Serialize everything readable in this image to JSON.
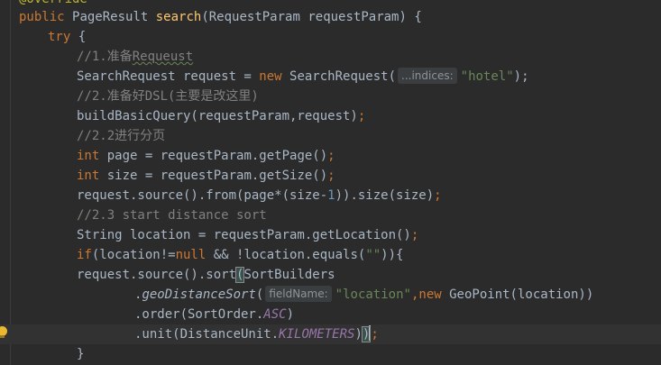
{
  "annotation": "@Override",
  "method_signature": {
    "public": "public",
    "return_type": "PageResult",
    "method_name": "search",
    "params": "(RequestParam requestParam) {"
  },
  "try_kw": "try",
  "try_brace": " {",
  "comment_1": "//1.准备Requeust",
  "line_request_a": "SearchRequest request = ",
  "new_kw": "new",
  "line_request_b": " SearchRequest(",
  "hint_indices": "...indices:",
  "str_hotel": "\"hotel\"",
  "line_request_end": ");",
  "comment_2": "//2.准备好DSL(主要是改这里)",
  "line_build": "buildBasicQuery(requestParam,request)",
  "semicolon": ";",
  "comment_2_2": "//2.2进行分页",
  "int_kw": "int",
  "line_page": " page = requestParam.getPage()",
  "line_size": " size = requestParam.getSize()",
  "line_from_a": "request.source().from(page*(size-",
  "num_one": "1",
  "line_from_b": ")).size(size)",
  "comment_2_3": "//2.3 start distance sort",
  "line_location": "String location = requestParam.getLocation()",
  "if_kw": "if",
  "line_if_a": "(location!=",
  "null_kw": "null",
  "line_if_b": " && !location.equals(",
  "str_empty": "\"\"",
  "line_if_c": ")){",
  "line_sort_a": "request.source().sort",
  "open_paren": "(",
  "line_sort_b": "SortBuilders",
  "dot": ".",
  "geo_method": "geoDistanceSort",
  "hint_fieldname": "fieldName:",
  "str_location": "\"location\"",
  "comma": ",",
  "line_geo_b": " GeoPoint(location))",
  "line_order_a": ".order(SortOrder.",
  "const_asc": "ASC",
  "close_paren": ")",
  "line_unit_a": ".unit(DistanceUnit.",
  "const_km": "KILOMETERS",
  "close_brace": "}"
}
